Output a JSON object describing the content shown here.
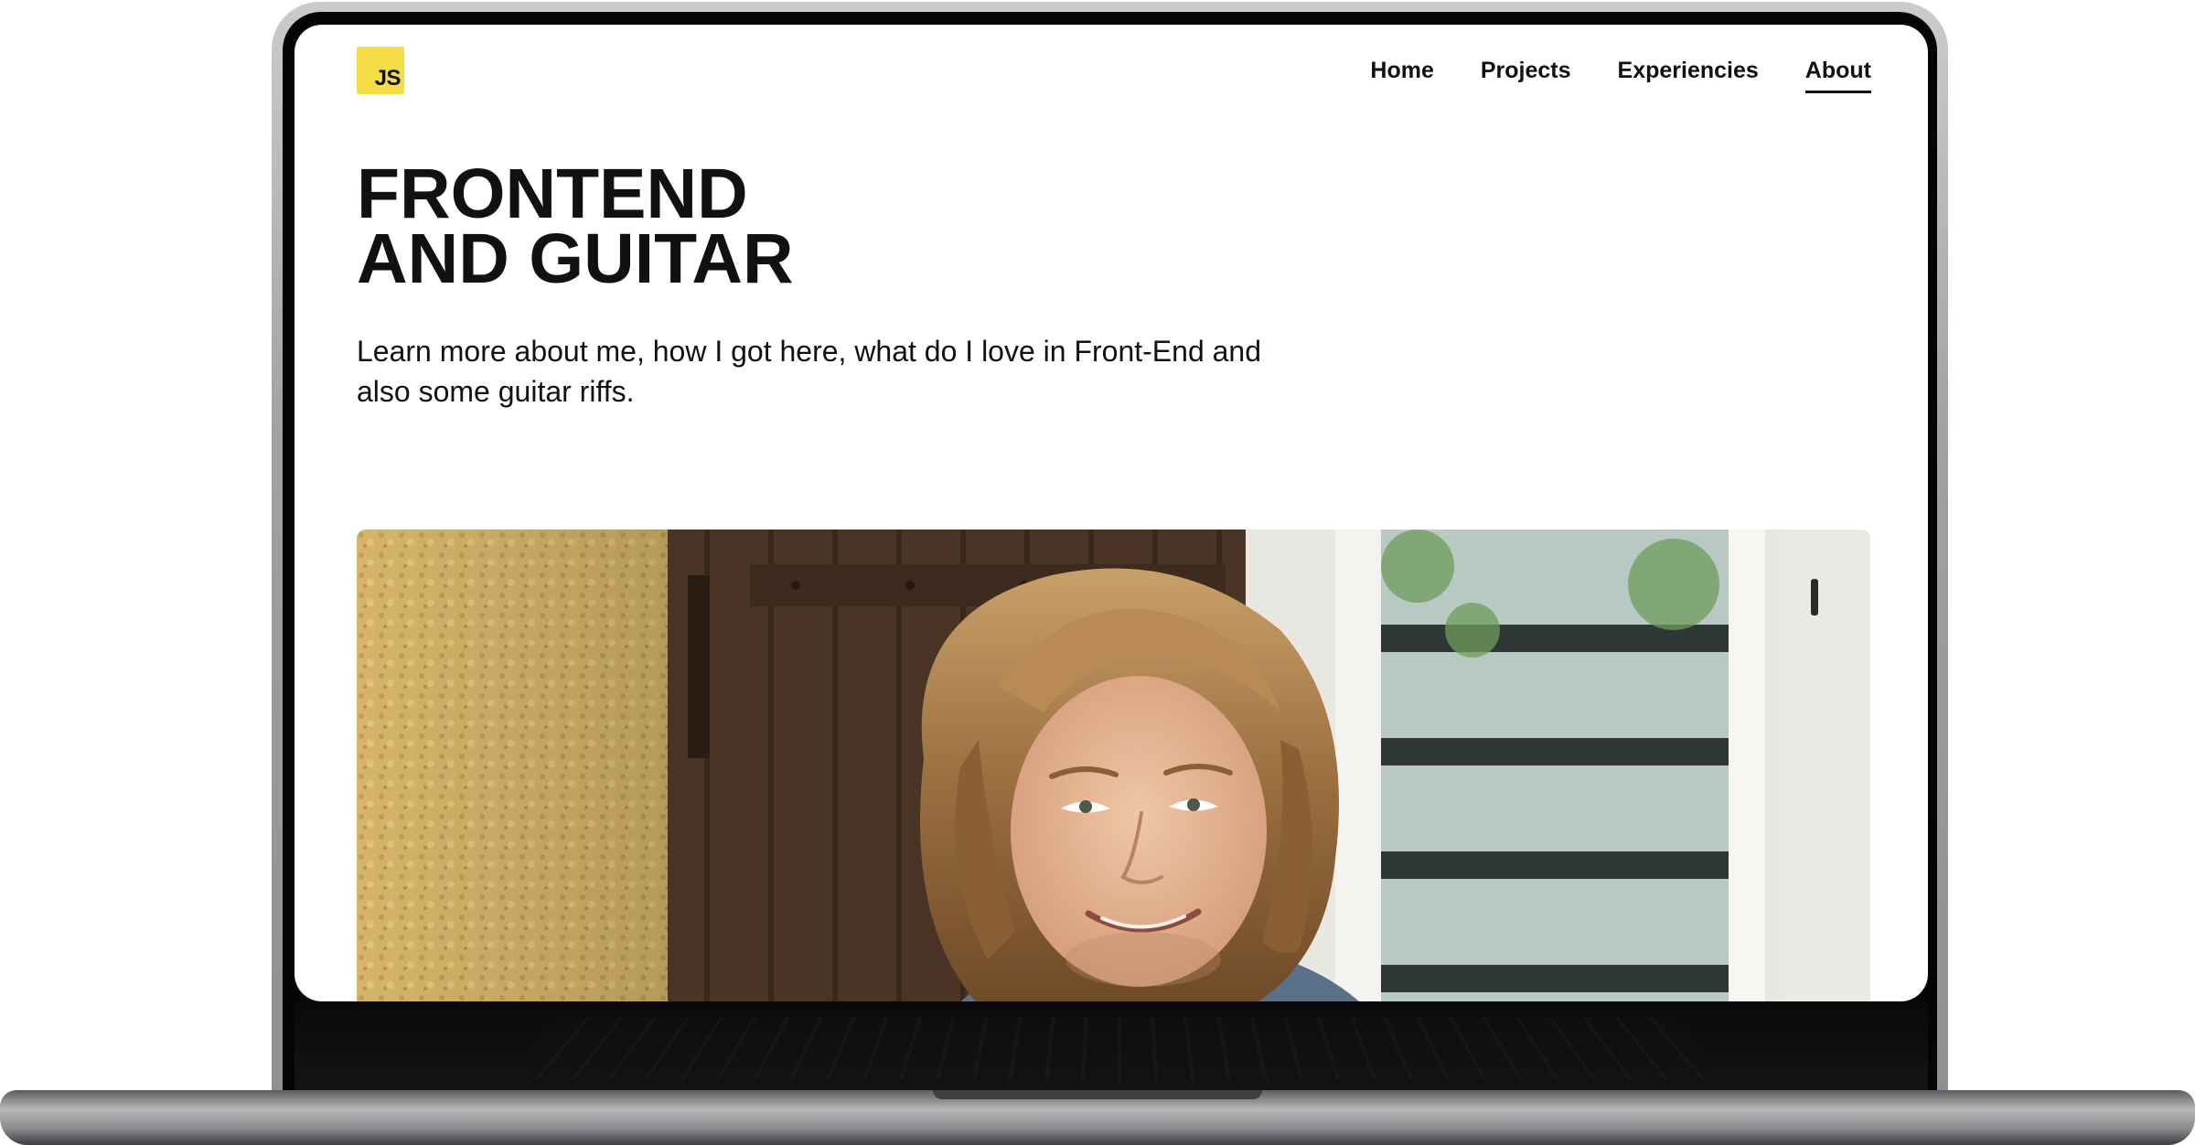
{
  "site": {
    "logo_text": "JS",
    "logo_color": "#f4dc45",
    "nav": {
      "items": [
        {
          "label": "Home"
        },
        {
          "label": "Projects"
        },
        {
          "label": "Experiencies"
        },
        {
          "label": "About"
        }
      ],
      "active": "About"
    },
    "hero": {
      "title_line1": "FRONTEND",
      "title_line2": "AND GUITAR",
      "description": "Learn more about me, how I got here, what do I love in Front-End and also some guitar riffs."
    },
    "photo": {
      "subject": "smiling person with long wavy hair outdoors"
    }
  }
}
